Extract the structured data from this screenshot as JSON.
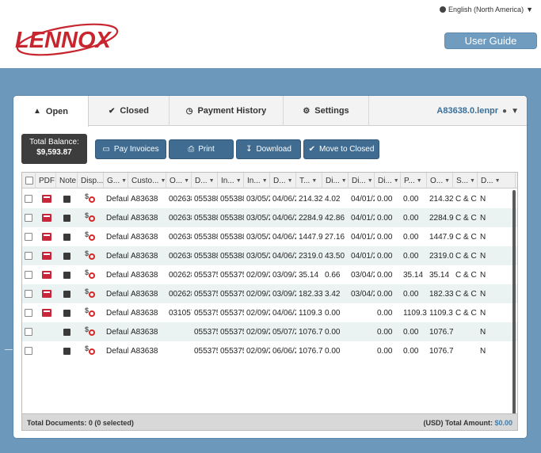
{
  "header": {
    "language": "English (North America)",
    "logo_text": "LENNOX",
    "user_guide": "User Guide"
  },
  "tabs": [
    {
      "label": "Open",
      "icon": "thumbs-up-icon",
      "active": true
    },
    {
      "label": "Closed",
      "icon": "check-icon"
    },
    {
      "label": "Payment History",
      "icon": "clock-icon"
    },
    {
      "label": "Settings",
      "icon": "gear-icon"
    }
  ],
  "account": "A83638.0.lenpr",
  "balance": {
    "label": "Total Balance:",
    "value": "$9,593.87"
  },
  "actions": [
    {
      "label": "Pay Invoices",
      "icon": "credit-card-icon"
    },
    {
      "label": "Print",
      "icon": "print-icon"
    },
    {
      "label": "Download",
      "icon": "download-icon"
    },
    {
      "label": "Move to Closed",
      "icon": "check-icon"
    }
  ],
  "columns": [
    "",
    "PDF",
    "Note",
    "Disp...",
    "G...",
    "Custo...",
    "O...",
    "D...",
    "In...",
    "In...",
    "D...",
    "T...",
    "Di...",
    "Di...",
    "Di...",
    "P...",
    "O...",
    "S...",
    "D..."
  ],
  "rows": [
    {
      "pdf": true,
      "group": "Default",
      "customer": "A83638",
      "c6": "002638",
      "c7": "055388",
      "c8": "055388",
      "c9": "03/05/2",
      "c10": "04/06/2",
      "c11": "214.32",
      "c12": "4.02",
      "c13": "04/01/2",
      "c14": "0.00",
      "c15": "0.00",
      "c16": "214.32",
      "c17": "C & C /",
      "c18": "N"
    },
    {
      "pdf": true,
      "group": "Default",
      "customer": "A83638",
      "c6": "002638",
      "c7": "055388",
      "c8": "055388",
      "c9": "03/05/2",
      "c10": "04/06/2",
      "c11": "2284.9",
      "c12": "42.86",
      "c13": "04/01/2",
      "c14": "0.00",
      "c15": "0.00",
      "c16": "2284.9",
      "c17": "C & C /",
      "c18": "N"
    },
    {
      "pdf": true,
      "group": "Default",
      "customer": "A83638",
      "c6": "002638",
      "c7": "055388",
      "c8": "055388",
      "c9": "03/05/2",
      "c10": "04/06/2",
      "c11": "1447.9",
      "c12": "27.16",
      "c13": "04/01/2",
      "c14": "0.00",
      "c15": "0.00",
      "c16": "1447.9",
      "c17": "C & C /",
      "c18": "N"
    },
    {
      "pdf": true,
      "group": "Default",
      "customer": "A83638",
      "c6": "002638",
      "c7": "055388",
      "c8": "055388",
      "c9": "03/05/2",
      "c10": "04/06/2",
      "c11": "2319.0",
      "c12": "43.50",
      "c13": "04/01/2",
      "c14": "0.00",
      "c15": "0.00",
      "c16": "2319.0",
      "c17": "C & C /",
      "c18": "N"
    },
    {
      "pdf": true,
      "group": "Default",
      "customer": "A83638",
      "c6": "002628",
      "c7": "055375",
      "c8": "055375",
      "c9": "02/09/2",
      "c10": "03/09/2",
      "c11": "35.14",
      "c12": "0.66",
      "c13": "03/04/2",
      "c14": "0.00",
      "c15": "35.14",
      "c16": "35.14",
      "c17": "C & C /",
      "c18": "N"
    },
    {
      "pdf": true,
      "group": "Default",
      "customer": "A83638",
      "c6": "002628",
      "c7": "055375",
      "c8": "055375",
      "c9": "02/09/2",
      "c10": "03/09/2",
      "c11": "182.33",
      "c12": "3.42",
      "c13": "03/04/2",
      "c14": "0.00",
      "c15": "0.00",
      "c16": "182.33",
      "c17": "C & C /",
      "c18": "N"
    },
    {
      "pdf": true,
      "group": "Default",
      "customer": "A83638",
      "c6": "031057",
      "c7": "055375",
      "c8": "055375",
      "c9": "02/09/2",
      "c10": "04/06/2",
      "c11": "1109.3",
      "c12": "0.00",
      "c13": "",
      "c14": "0.00",
      "c15": "1109.3",
      "c16": "1109.3",
      "c17": "C & C /",
      "c18": "N"
    },
    {
      "pdf": false,
      "group": "Default",
      "customer": "A83638",
      "c6": "",
      "c7": "055375",
      "c8": "055375",
      "c9": "02/09/2",
      "c10": "05/07/2",
      "c11": "1076.7",
      "c12": "0.00",
      "c13": "",
      "c14": "0.00",
      "c15": "0.00",
      "c16": "1076.7",
      "c17": "",
      "c18": "N"
    },
    {
      "pdf": false,
      "group": "Default",
      "customer": "A83638",
      "c6": "",
      "c7": "055375",
      "c8": "055375",
      "c9": "02/09/2",
      "c10": "06/06/2",
      "c11": "1076.7",
      "c12": "0.00",
      "c13": "",
      "c14": "0.00",
      "c15": "0.00",
      "c16": "1076.7",
      "c17": "",
      "c18": "N"
    }
  ],
  "footer": {
    "documents": "Total Documents: 0 (0 selected)",
    "amount_label": "(USD) Total Amount:",
    "amount_value": "$0.00"
  },
  "colors": {
    "brand_red": "#c8262f",
    "band": "#6c99bb",
    "button": "#3f6c90",
    "accent_blue": "#3c6f96"
  }
}
